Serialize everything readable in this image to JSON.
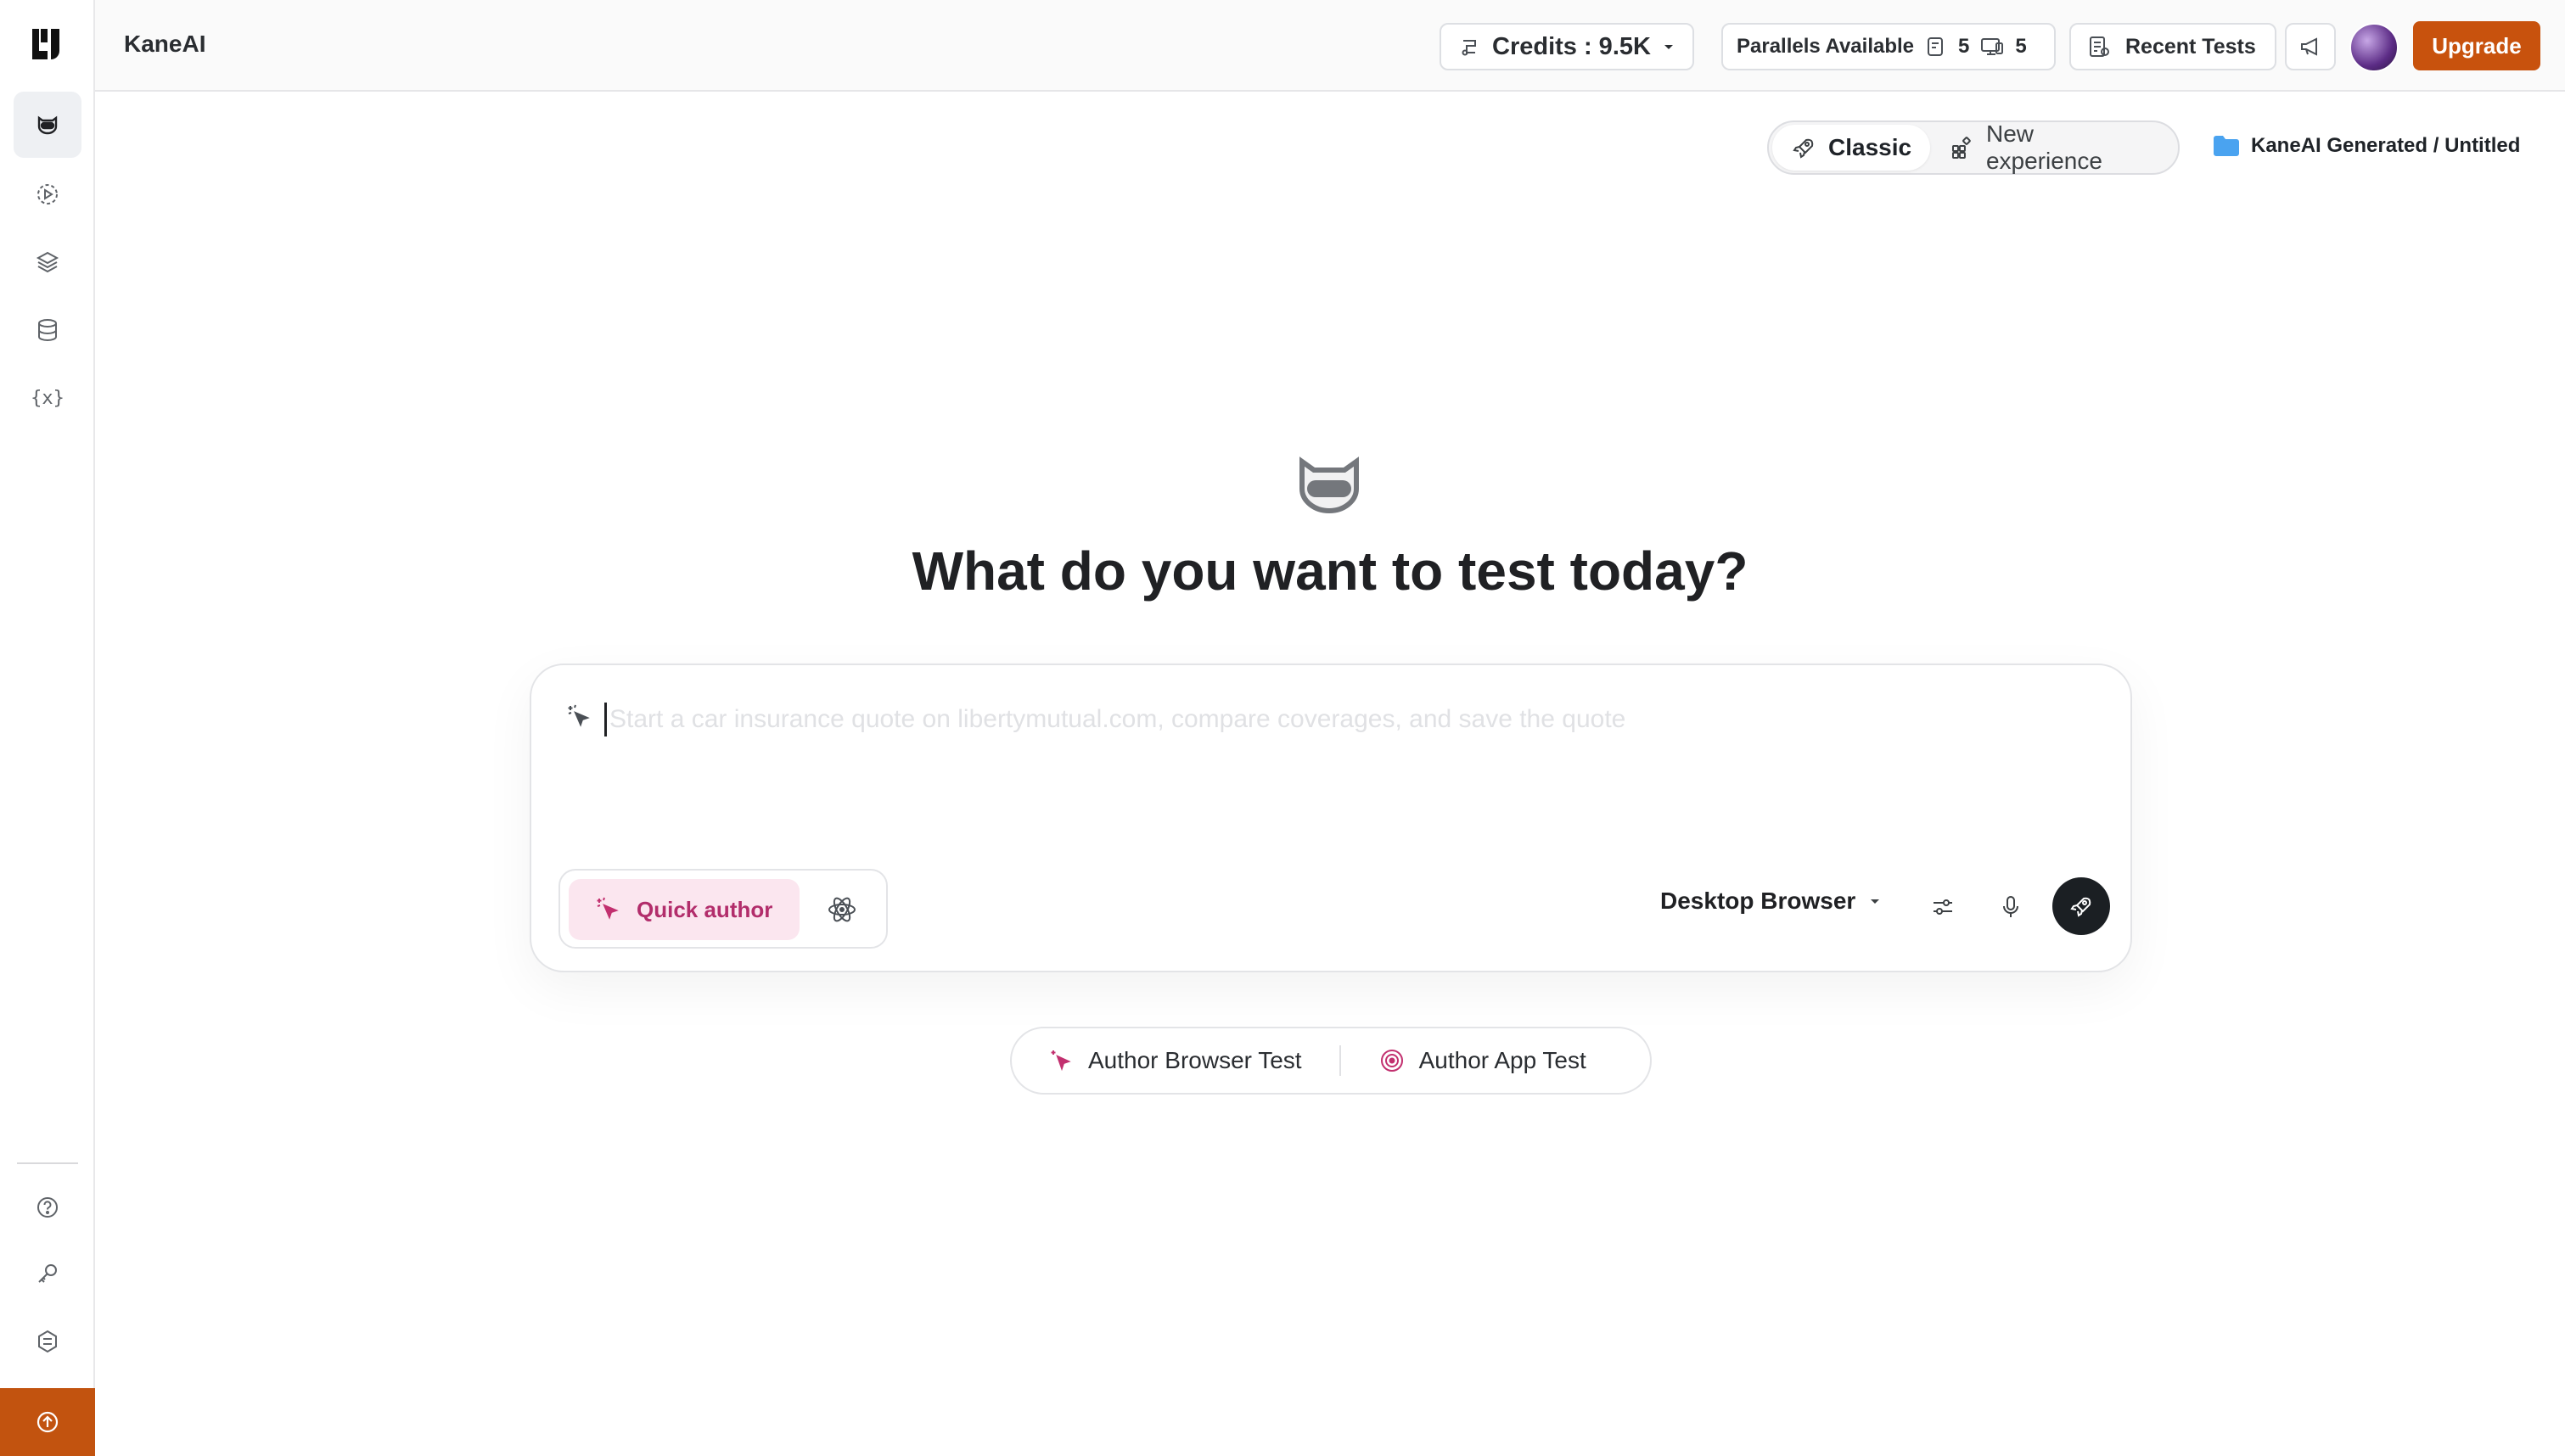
{
  "app": {
    "title": "KaneAI"
  },
  "topbar": {
    "credits_label": "Credits : 9.5K",
    "parallels_label": "Parallels Available",
    "parallels_browser_count": "5",
    "parallels_app_count": "5",
    "recent_tests_label": "Recent Tests",
    "upgrade_label": "Upgrade"
  },
  "mode_toggle": {
    "options": [
      {
        "label": "Classic",
        "active": true
      },
      {
        "label": "New experience",
        "active": false
      }
    ]
  },
  "breadcrumb": {
    "path": "KaneAI Generated / Untitled"
  },
  "hero": {
    "headline": "What do you want to test today?"
  },
  "prompt": {
    "value": "",
    "placeholder": "Start a car insurance quote on libertymutual.com, compare coverages, and save the quote"
  },
  "authoring": {
    "quick_author_label": "Quick author",
    "device_label": "Desktop Browser"
  },
  "author_options": [
    {
      "label": "Author Browser Test"
    },
    {
      "label": "Author App Test"
    }
  ],
  "sidebar": {
    "items": [
      {
        "icon": "kane-bot-icon",
        "active": true
      },
      {
        "icon": "test-run-icon",
        "active": false
      },
      {
        "icon": "layers-icon",
        "active": false
      },
      {
        "icon": "database-icon",
        "active": false
      },
      {
        "icon": "variables-icon",
        "label": "{x}",
        "active": false
      }
    ],
    "bottom_items": [
      {
        "icon": "help-icon"
      },
      {
        "icon": "key-icon"
      },
      {
        "icon": "integrations-icon"
      }
    ]
  },
  "colors": {
    "accent": "#c8520d",
    "quick_author_bg": "#fbe6ef",
    "quick_author_text": "#b22d6b",
    "send_button": "#1b1f23",
    "folder": "#4aa3f0"
  }
}
